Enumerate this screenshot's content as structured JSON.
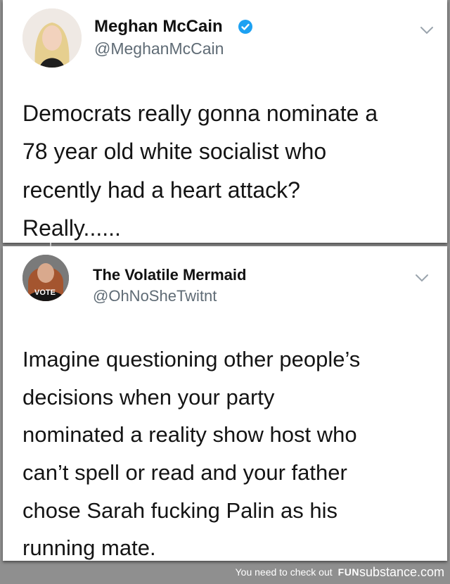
{
  "tweets": [
    {
      "name": "Meghan McCain",
      "handle": "@MeghanMcCain",
      "verified": true,
      "text": "Democrats really gonna nominate a\n78 year old white socialist who\nrecently had a heart attack?\nReally......"
    },
    {
      "name": "The Volatile Mermaid",
      "handle": "@OhNoSheTwitnt",
      "avatar_text": "VOTE",
      "text": "Imagine questioning other people’s\ndecisions when your party\nnominated a reality show host who\ncan’t spell or read and your father\nchose Sarah fucking Palin as his\nrunning mate."
    }
  ],
  "footer": {
    "text": "You need to check out",
    "brand": "FUN",
    "brand_sub": "substance.com"
  },
  "colors": {
    "background": "#8f8f8f",
    "verified": "#1da1f2",
    "handle": "#5f6b75"
  }
}
